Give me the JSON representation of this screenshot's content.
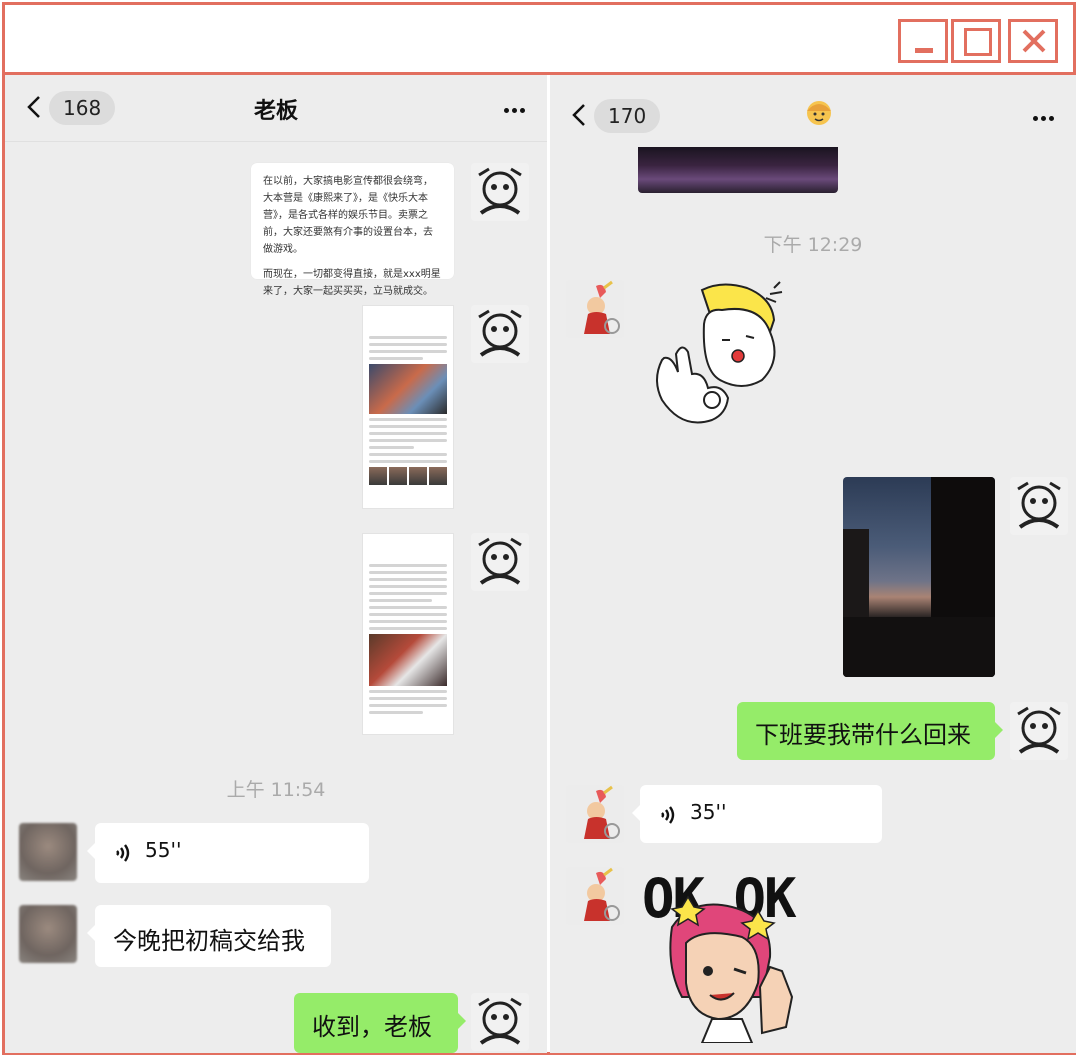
{
  "left": {
    "badge": "168",
    "title": "老板",
    "doc_paragraph1": "在以前，大家搞电影宣传都很会绕弯，大本营是《康熙来了》，是《快乐大本营》，是各式各样的娱乐节目。卖票之前，大家还要煞有介事的设置台本，去做游戏。",
    "doc_paragraph2": "而现在，一切都变得直接，就是xxx明星来了，大家一起买买买，立马就成交。",
    "timestamp": "上午 11:54",
    "voice_duration": "55''",
    "message_text": "今晚把初稿交给我",
    "reply_text": "收到，老板"
  },
  "right": {
    "badge": "170",
    "timestamp": "下午 12:29",
    "message_text": "下班要我带什么回来",
    "voice_duration": "35''",
    "sticker_text": "OK OK"
  },
  "icons": {
    "back": "chevron-left-icon",
    "more": "more-icon",
    "voice": "voice-icon",
    "minimize": "minimize-icon",
    "maximize": "maximize-icon",
    "close": "close-icon"
  },
  "colors": {
    "frame": "#e26f5f",
    "chat_bg": "#ededed",
    "green_bubble": "#95ec69",
    "white_bubble": "#ffffff"
  }
}
